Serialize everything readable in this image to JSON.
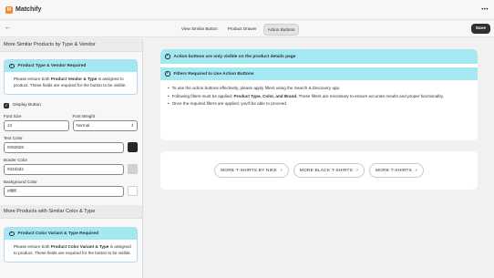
{
  "app": {
    "title": "Matchify",
    "logo_letter": "M",
    "menu_icon": "more-horizontal-icon",
    "menu_glyph": "•••"
  },
  "toolbar": {
    "back_glyph": "←",
    "tabs": [
      {
        "label": "View Similar Button",
        "active": false
      },
      {
        "label": "Product Drawer",
        "active": false
      },
      {
        "label": "Action Buttons",
        "active": true
      }
    ],
    "save_label": "Save"
  },
  "left": {
    "section1_title": "More Similar Products by Type & Vendor",
    "banner1": {
      "title": "Product Type & Vendor Required",
      "text_a": "Please ensure both ",
      "text_b": "Product Vendor & Type",
      "text_c": " is assigned to product. These fields are required for the button to be visible."
    },
    "display_button_label": "Display Button",
    "font_size_label": "Font Size",
    "font_size_value": "13",
    "font_weight_label": "Font Weight",
    "font_weight_value": "Normal",
    "text_color_label": "Text Color",
    "text_color_value": "#282828",
    "border_color_label": "Border Color",
    "border_color_value": "#d2d2d2",
    "bg_color_label": "Background Color",
    "bg_color_value": "#ffffff",
    "section2_title": "More Products with Similar Color & Type",
    "banner2": {
      "title": "Product Color Variant & Type Required",
      "text_a": "Please ensure both ",
      "text_b": "Product Color Variant & Type",
      "text_c": " is assigned to product. These fields are required for the button to be visible."
    }
  },
  "preview": {
    "visibility_note": "Action buttons are only visible on the product details page",
    "alert_title": "Filters Required to Use Action Buttons",
    "bullet1_a": "To use the action buttons effectively, please apply filters using the Search & Discovery app. ",
    "bullet1_b": "Search & Discovery app.",
    "bullet2_a": "Following filters must be applied: ",
    "bullet2_b": "Product Type, Color, and Brand.",
    "bullet2_c": " These filters are necessary to ensure accurate results and proper functionality.",
    "bullet3": "Once the required filters are applied, you'll be able to proceed.",
    "buttons": [
      "MORE T-SHIRTS BY NIKE",
      "MORE BLACK T-SHIRTS",
      "MORE T-SHIRTS"
    ]
  },
  "colors": {
    "accent_banner": "#a4e8f2",
    "logo": "#f28c28",
    "text_swatch": "#282828",
    "border_swatch": "#d2d2d2",
    "bg_swatch": "#ffffff"
  }
}
